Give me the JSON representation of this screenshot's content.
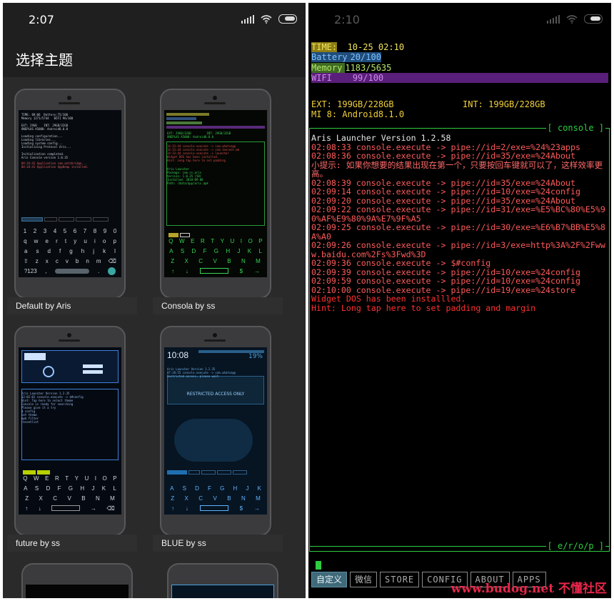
{
  "left": {
    "status_time": "2:07",
    "title": "选择主题",
    "themes": [
      {
        "name": "Default by Aris"
      },
      {
        "name": "Consola by ss"
      },
      {
        "name": "future by ss"
      },
      {
        "name": "BLUE by ss"
      }
    ]
  },
  "right": {
    "status_time": "2:10",
    "header": {
      "time_label": "TIME:",
      "time_value": "10-25 02:10",
      "battery_label": "Battery",
      "battery_value": "20/100",
      "memory_label": "Memory",
      "memory_value": "1183/5635",
      "wifi_label": "WIFI",
      "wifi_value": "99/100"
    },
    "ext": "EXT: 199GB/228GB",
    "int": "INT: 199GB/228GB",
    "device": "MI 8: Android8.1.0",
    "console_tag": "[ console ]",
    "log": [
      {
        "text": "Aris Launcher Version 1.2.58",
        "color": "#e6e6e6"
      },
      {
        "text": "02:08:33 console.execute -> pipe://id=2/exe=%24%23apps",
        "color": "#ff5a5a"
      },
      {
        "text": "02:08:36 console.execute -> pipe://id=35/exe=%24About",
        "color": "#ff5a5a"
      },
      {
        "text": "小提示: 如果你想要的结果出现在第一个，只要按回车键就可以了，这样效率更高。",
        "color": "#ff6a6a"
      },
      {
        "text": "02:08:39 console.execute -> pipe://id=35/exe=%24About",
        "color": "#ff5a5a"
      },
      {
        "text": "02:09:14 console.execute -> pipe://id=10/exe=%24config",
        "color": "#ff5a5a"
      },
      {
        "text": "02:09:20 console.execute -> pipe://id=35/exe=%24About",
        "color": "#ff5a5a"
      },
      {
        "text": "02:09:22 console.execute -> pipe://id=31/exe=%E5%BC%80%E5%90%AF%E9%80%9A%E7%9F%A5",
        "color": "#ff5a5a"
      },
      {
        "text": "02:09:25 console.execute -> pipe://id=30/exe=%E6%B7%BB%E5%8A%A0",
        "color": "#ff5a5a"
      },
      {
        "text": "02:09:26 console.execute -> pipe://id=3/exe=http%3A%2F%2Fwww.baidu.com%2Fs%3Fwd%3D",
        "color": "#ff5a5a"
      },
      {
        "text": "02:09:36 console.execute -> $#config",
        "color": "#ff5a5a"
      },
      {
        "text": "02:09:39 console.execute -> pipe://id=10/exe=%24config",
        "color": "#ff5a5a"
      },
      {
        "text": "02:09:59 console.execute -> pipe://id=10/exe=%24config",
        "color": "#ff5a5a"
      },
      {
        "text": "02:10:00 console.execute -> pipe://id=19/exe=%24store",
        "color": "#ff5a5a"
      },
      {
        "text": "Widget DOS has been installled.",
        "color": "#ff3030"
      },
      {
        "text": "Hint: Long tap here to set padding and margin",
        "color": "#ff3030"
      }
    ],
    "erop_tag": "[ e/r/o/p ]",
    "buttons": [
      "自定义",
      "微信",
      "STORE",
      "CONFIG",
      "ABOUT",
      "APPS"
    ],
    "watermark": "www.budog.net 不懂社区"
  }
}
